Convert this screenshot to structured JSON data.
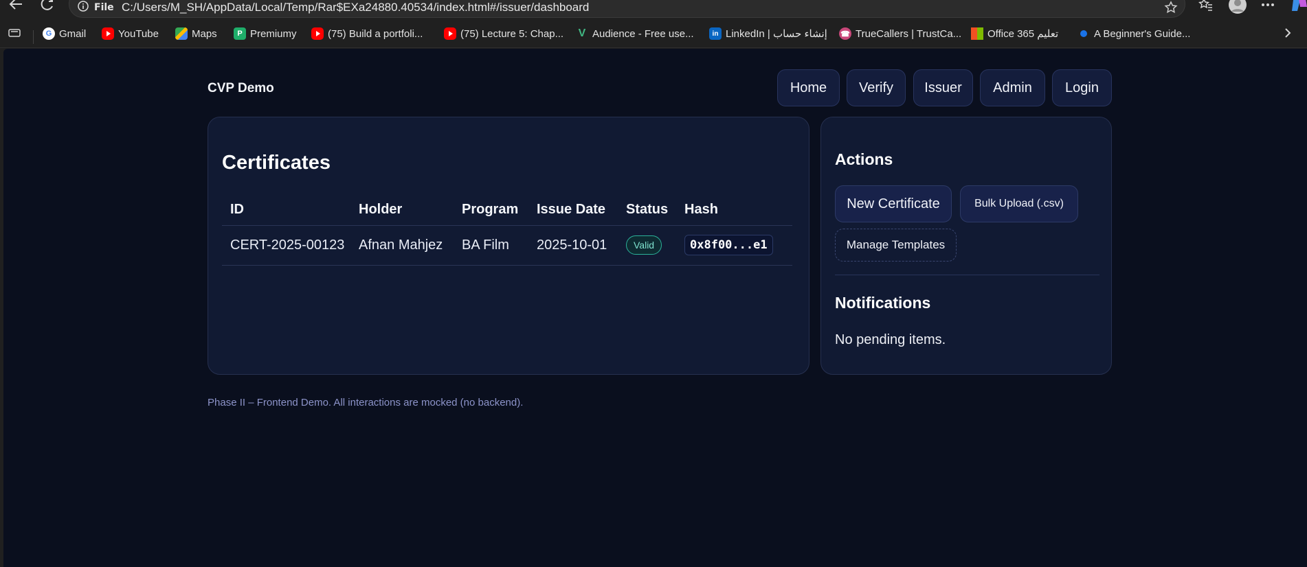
{
  "browser": {
    "address": {
      "info_label": "File",
      "url": "C:/Users/M_SH/AppData/Local/Temp/Rar$EXa24880.40534/index.html#/issuer/dashboard"
    },
    "icons": [
      "back-icon",
      "refresh-icon",
      "info-icon",
      "star-icon",
      "favorites-icon",
      "profile-icon",
      "more-icon",
      "copilot-icon"
    ],
    "bookmarks": [
      {
        "label": "Gmail",
        "icon": "google-icon"
      },
      {
        "label": "YouTube",
        "icon": "youtube-icon"
      },
      {
        "label": "Maps",
        "icon": "maps-icon"
      },
      {
        "label": "Premiumy",
        "icon": "premiumy-icon"
      },
      {
        "label": "(75) Build a portfoli...",
        "icon": "youtube-icon"
      },
      {
        "label": "(75) Lecture 5: Chap...",
        "icon": "youtube-icon"
      },
      {
        "label": "Audience - Free use...",
        "icon": "vuetify-icon"
      },
      {
        "label": "LinkedIn | إنشاء حساب",
        "icon": "linkedin-icon"
      },
      {
        "label": "TrueCallers | TrustCa...",
        "icon": "truecaller-icon"
      },
      {
        "label": "Office 365 تعليم",
        "icon": "microsoft-icon"
      },
      {
        "label": "A Beginner's Guide...",
        "icon": "dot-icon"
      }
    ]
  },
  "app": {
    "brand": "CVP Demo",
    "nav": [
      "Home",
      "Verify",
      "Issuer",
      "Admin",
      "Login"
    ]
  },
  "certificates": {
    "title": "Certificates",
    "columns": [
      "ID",
      "Holder",
      "Program",
      "Issue Date",
      "Status",
      "Hash"
    ],
    "rows": [
      {
        "id": "CERT-2025-00123",
        "holder": "Afnan Mahjez",
        "program": "BA Film",
        "issue_date": "2025-10-01",
        "status": "Valid",
        "hash": "0x8f00...e1"
      }
    ]
  },
  "actions": {
    "title": "Actions",
    "new_certificate": "New Certificate",
    "bulk_upload": "Bulk Upload (.csv)",
    "manage_templates": "Manage Templates"
  },
  "notifications": {
    "title": "Notifications",
    "text": "No pending items."
  },
  "footer": "Phase II – Frontend Demo. All interactions are mocked (no backend).",
  "colors": {
    "page_bg": "#0a0f1e",
    "card_bg": "#111a33",
    "accent_valid": "#2bb39a"
  }
}
